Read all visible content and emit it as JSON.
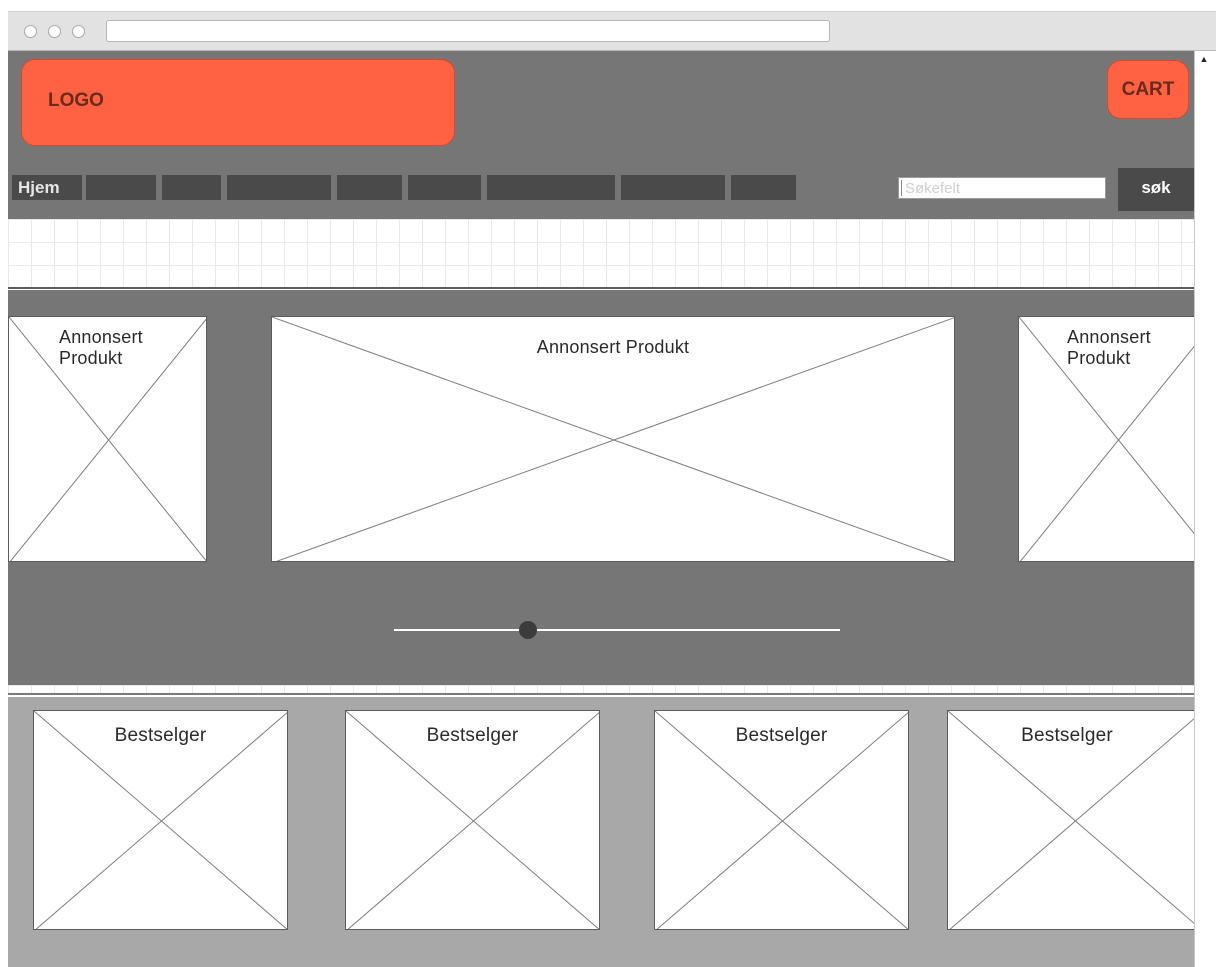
{
  "header": {
    "logo_label": "LOGO",
    "cart_label": "CART"
  },
  "nav": {
    "home_label": "Hjem",
    "placeholder_item_count": 8
  },
  "search": {
    "placeholder": "Søkefelt",
    "button_label": "søk"
  },
  "carousel": {
    "items": [
      {
        "label": "Annonsert\nProdukt"
      },
      {
        "label": "Annonsert Produkt"
      },
      {
        "label": "Annonsert\nProdukt"
      }
    ],
    "slider_position": 0.3
  },
  "bestsellers": {
    "items": [
      {
        "label": "Bestselger"
      },
      {
        "label": "Bestselger"
      },
      {
        "label": "Bestselger"
      },
      {
        "label": "Bestselger"
      }
    ]
  },
  "colors": {
    "accent": "#ff6242",
    "header_bg": "#767676",
    "nav_bg": "#4a4a4a",
    "bestseller_bg": "#a8a8a8"
  }
}
